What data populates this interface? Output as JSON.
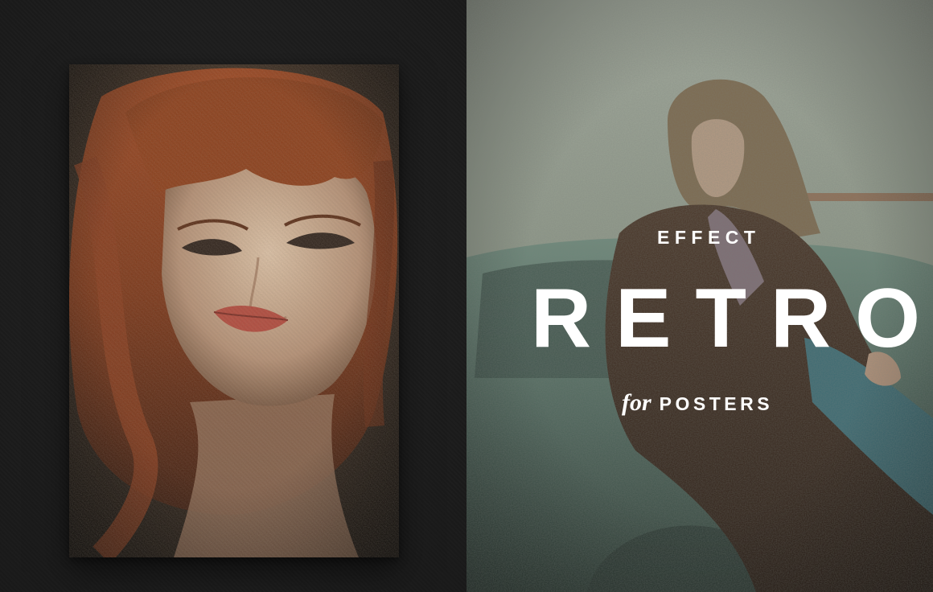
{
  "left_panel": {
    "background_color": "#1c1c1c",
    "photo": {
      "subject": "red-haired woman portrait",
      "hair_color": "#8a3b1c",
      "skin_color": "#c9a98c",
      "lip_color": "#b5493c"
    }
  },
  "right_panel": {
    "background_color": "#8d958a",
    "photo": {
      "subject": "woman leaning on vintage car",
      "car_color": "#4f665c",
      "coat_color": "#3b2a20",
      "jeans_color": "#3d6b73"
    },
    "title": {
      "effect_label": "EFFECT",
      "main_word": "RETRO",
      "for_word": "for",
      "posters_label": "POSTERS",
      "text_color": "#ffffff"
    }
  }
}
